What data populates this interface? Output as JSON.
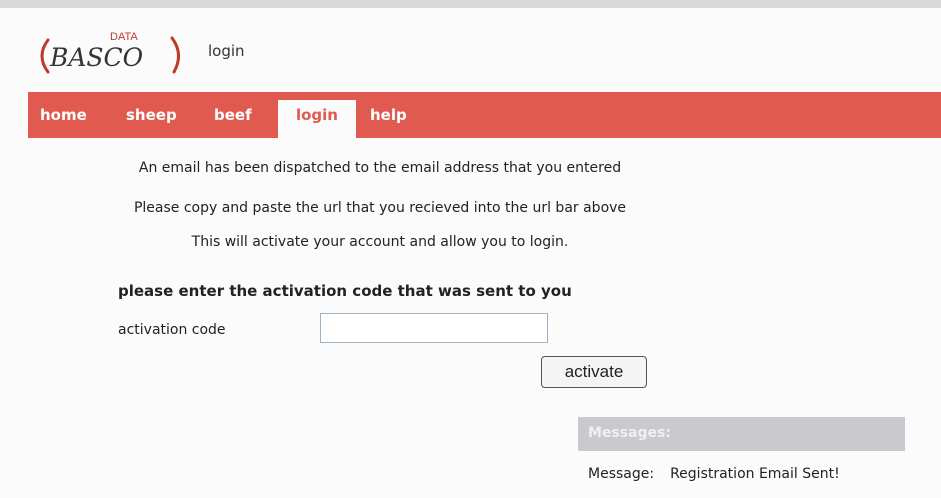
{
  "header": {
    "logo_main": "BASCO",
    "logo_super": "DATA",
    "page_label": "login"
  },
  "nav": {
    "items": [
      {
        "label": "home"
      },
      {
        "label": "sheep"
      },
      {
        "label": "beef"
      },
      {
        "label": "login"
      },
      {
        "label": "help"
      }
    ],
    "active": "login"
  },
  "info": {
    "line1": "An email has been dispatched to the email address that you entered",
    "line2": "Please copy and paste the url that you recieved into the url bar above",
    "line3": "This will activate your account and allow you to login."
  },
  "form": {
    "heading": "please enter the activation code that was sent to you",
    "field_label": "activation code",
    "field_value": "",
    "button_label": "activate"
  },
  "messages": {
    "title": "Messages:",
    "label": "Message:",
    "text": "Registration Email Sent!"
  },
  "colors": {
    "nav_bg": "#e05a4f",
    "messages_bg": "#c9c9ce",
    "logo_red": "#c0392b",
    "logo_ink": "#333333"
  },
  "icons": {
    "logo": "basco-data-logo"
  }
}
